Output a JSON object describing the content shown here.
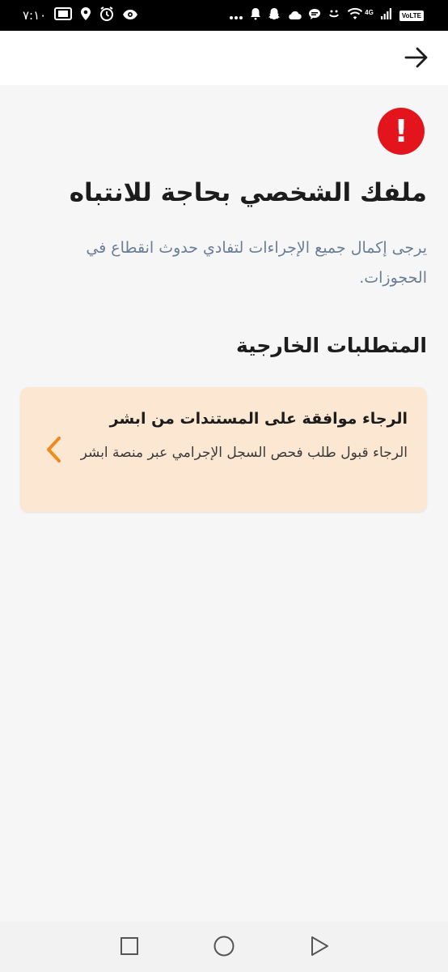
{
  "status_bar": {
    "time": "٧:١٠",
    "network_badge": "VoLTE",
    "network_type": "4G",
    "icons_left": [
      "photo-icon",
      "location-icon",
      "alarm-icon",
      "eye-icon"
    ],
    "icons_right": [
      "more-icon",
      "notification-icon",
      "snapchat-icon",
      "cloud-icon",
      "chat-icon",
      "face-icon",
      "wifi-icon",
      "signal-icon"
    ]
  },
  "header": {
    "back_icon": "arrow-right-icon"
  },
  "alert": {
    "icon": "exclamation-icon",
    "color": "#e3141b",
    "glyph": "!"
  },
  "main": {
    "title": "ملفك الشخصي بحاجة للانتباه",
    "subtitle": "يرجى إكمال جميع الإجراءات لتفادي حدوث انقطاع في الحجوزات.",
    "section_title": "المتطلبات الخارجية"
  },
  "requirement_card": {
    "title": "الرجاء موافقة على المستندات من ابشر",
    "description": "الرجاء قبول طلب فحص السجل الإجرامي عبر منصة ابشر",
    "chevron_color": "#f08a1c",
    "background": "#fce8d2"
  },
  "nav_bar": {
    "buttons": [
      "recents-icon",
      "home-icon",
      "back-triangle-icon"
    ]
  }
}
